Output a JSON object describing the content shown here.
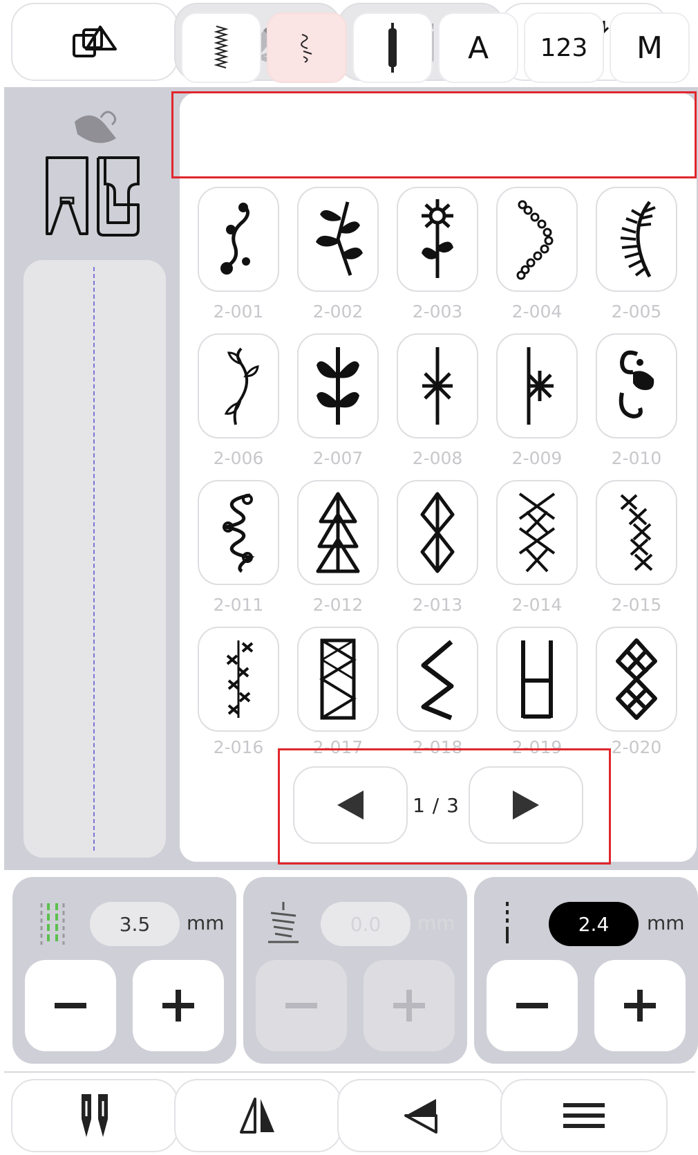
{
  "toolbar": {
    "buttons": [
      {
        "icon": "stitch-copy-icon",
        "enabled": true
      },
      {
        "icon": "eraser-icon",
        "enabled": false
      },
      {
        "icon": "trash-icon",
        "enabled": false
      },
      {
        "icon": "stitch-import-icon",
        "enabled": true
      }
    ]
  },
  "left_panel": {
    "foot_pedal_icon": "foot-pedal-icon",
    "presser_foot_icon": "presser-foot-icon",
    "seam_preview_icon": "stitch-seam-icon"
  },
  "tabs": [
    {
      "label": "",
      "icon": "straight-stitch-icon"
    },
    {
      "label": "",
      "icon": "decorative-stitch-icon",
      "active": true
    },
    {
      "label": "",
      "icon": "buttonhole-icon"
    },
    {
      "label": "A"
    },
    {
      "label": "123"
    },
    {
      "label": "M"
    }
  ],
  "patterns": [
    {
      "code": "2-001",
      "icon": "scroll-dots-icon"
    },
    {
      "code": "2-002",
      "icon": "leaf-branch-icon"
    },
    {
      "code": "2-003",
      "icon": "flower-stem-icon"
    },
    {
      "code": "2-004",
      "icon": "flower-chain-icon"
    },
    {
      "code": "2-005",
      "icon": "fern-icon"
    },
    {
      "code": "2-006",
      "icon": "vine-icon"
    },
    {
      "code": "2-007",
      "icon": "leaf-stem-icon"
    },
    {
      "code": "2-008",
      "icon": "star-stem-icon"
    },
    {
      "code": "2-009",
      "icon": "half-star-icon"
    },
    {
      "code": "2-010",
      "icon": "curl-flower-icon"
    },
    {
      "code": "2-011",
      "icon": "loop-chain-icon"
    },
    {
      "code": "2-012",
      "icon": "triangle-tree-icon"
    },
    {
      "code": "2-013",
      "icon": "diamond-chain-icon"
    },
    {
      "code": "2-014",
      "icon": "cross-diamond-icon"
    },
    {
      "code": "2-015",
      "icon": "cross-stitch-icon"
    },
    {
      "code": "2-016",
      "icon": "feather-cross-icon"
    },
    {
      "code": "2-017",
      "icon": "zigzag-box-icon"
    },
    {
      "code": "2-018",
      "icon": "zigzag-icon"
    },
    {
      "code": "2-019",
      "icon": "ladder-icon"
    },
    {
      "code": "2-020",
      "icon": "lattice-icon"
    }
  ],
  "pagination": {
    "indicator": "1 / 3",
    "prev_icon": "arrow-left-icon",
    "next_icon": "arrow-right-icon"
  },
  "controls": {
    "width": {
      "icon": "stitch-width-icon",
      "value": "3.5",
      "unit": "mm",
      "enabled": true
    },
    "tension": {
      "icon": "tension-icon",
      "value": "0.0",
      "unit": "mm",
      "enabled": false
    },
    "length": {
      "icon": "stitch-length-icon",
      "value": "2.4",
      "unit": "mm",
      "enabled": true
    }
  },
  "bottom_bar": {
    "buttons": [
      {
        "icon": "twin-needle-icon"
      },
      {
        "icon": "mirror-icon"
      },
      {
        "icon": "reverse-direction-icon"
      },
      {
        "icon": "menu-icon"
      }
    ]
  }
}
